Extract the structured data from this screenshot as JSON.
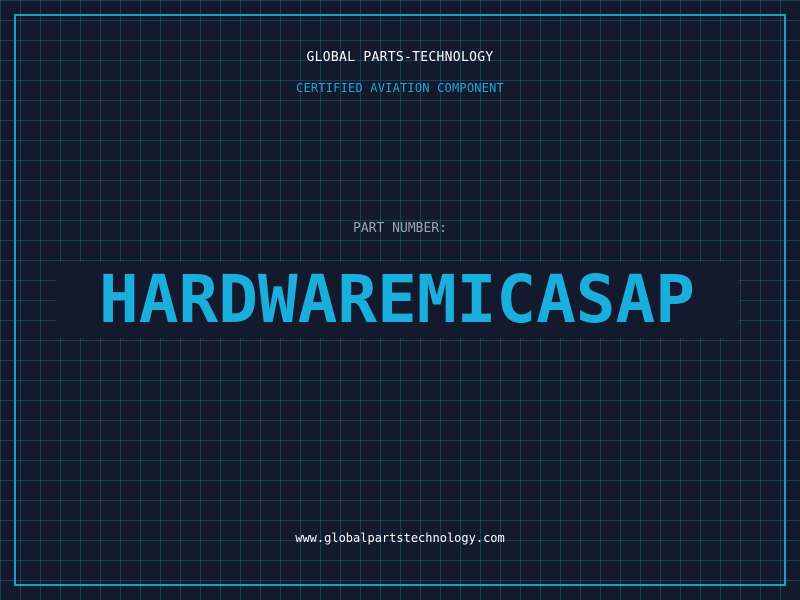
{
  "header": {
    "company": "GLOBAL PARTS-TECHNOLOGY",
    "subtitle": "CERTIFIED AVIATION COMPONENT"
  },
  "part": {
    "label": "PART NUMBER:",
    "value": "HARDWAREMICASAP"
  },
  "footer": {
    "url": "www.globalpartstechnology.com"
  },
  "colors": {
    "background": "#131a2e",
    "grid": "#1e5f78",
    "border": "#1a9fc2",
    "accent": "#1aaedc",
    "label": "#9aa3b5",
    "text": "#ffffff"
  }
}
